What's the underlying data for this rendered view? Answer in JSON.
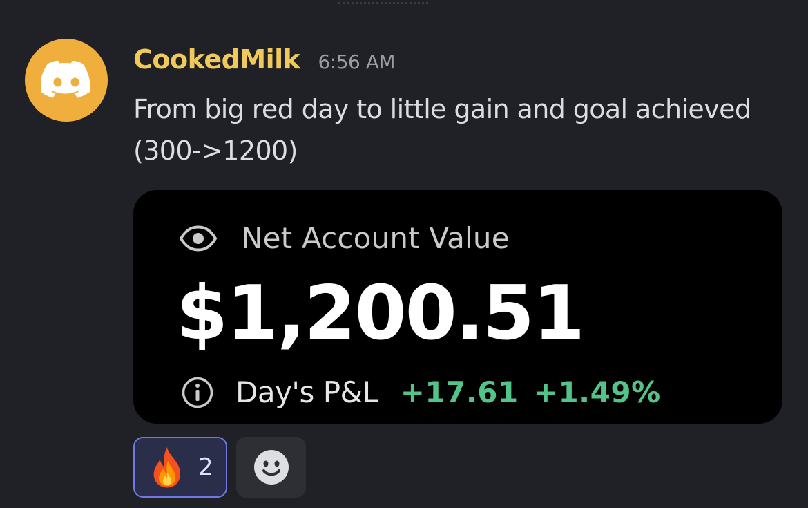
{
  "author": {
    "username": "CookedMilk",
    "timestamp": "6:56 AM",
    "avatar_icon": "discord-logo-icon",
    "name_color": "#f0c95a",
    "avatar_color": "#f0ae3d"
  },
  "message": {
    "text": "From big red day to little gain and goal achieved (300->1200)"
  },
  "embed": {
    "label": "Net Account Value",
    "balance": "$1,200.51",
    "pnl_label": "Day's P&L",
    "pnl_value": "+17.61",
    "pnl_percent": "+1.49%",
    "gain_color": "#53c38a",
    "icons": {
      "visibility": "eye-icon",
      "info": "info-icon"
    }
  },
  "reactions": [
    {
      "emoji_icon": "fire-icon",
      "count": "2"
    }
  ],
  "add_reaction_icon": "smiley-icon"
}
